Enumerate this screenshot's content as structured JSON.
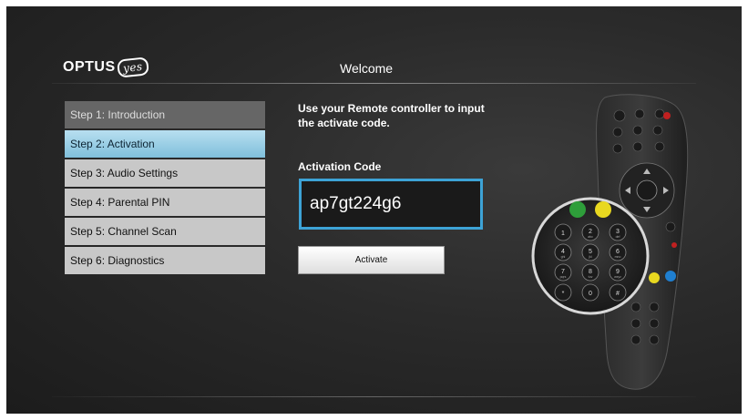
{
  "brand": {
    "name": "OPTUS",
    "tag": "yes"
  },
  "header": {
    "title": "Welcome"
  },
  "steps": [
    {
      "label": "Step 1: Introduction",
      "state": "done"
    },
    {
      "label": "Step 2: Activation",
      "state": "active"
    },
    {
      "label": "Step 3: Audio Settings",
      "state": "pending"
    },
    {
      "label": "Step 4: Parental PIN",
      "state": "pending"
    },
    {
      "label": "Step 5: Channel Scan",
      "state": "pending"
    },
    {
      "label": "Step 6: Diagnostics",
      "state": "pending"
    }
  ],
  "main": {
    "instruction": "Use your Remote controller to input the activate code.",
    "code_label": "Activation Code",
    "code_value": "ap7gt224g6",
    "activate_label": "Activate"
  },
  "remote": {
    "keypad": [
      {
        "digit": "1",
        "sub": ""
      },
      {
        "digit": "2",
        "sub": "abc"
      },
      {
        "digit": "3",
        "sub": "def"
      },
      {
        "digit": "4",
        "sub": "ghi"
      },
      {
        "digit": "5",
        "sub": "jkl"
      },
      {
        "digit": "6",
        "sub": "mno"
      },
      {
        "digit": "7",
        "sub": "pqrs"
      },
      {
        "digit": "8",
        "sub": "tuv"
      },
      {
        "digit": "9",
        "sub": "wxyz"
      },
      {
        "digit": "*",
        "sub": ""
      },
      {
        "digit": "0",
        "sub": ""
      },
      {
        "digit": "#",
        "sub": ""
      }
    ]
  },
  "colors": {
    "accent": "#3da3d6",
    "active_step": "#8ecae4",
    "green_key": "#2e9e3a",
    "yellow_key": "#e8d820",
    "blue_key": "#1f7fd0"
  }
}
